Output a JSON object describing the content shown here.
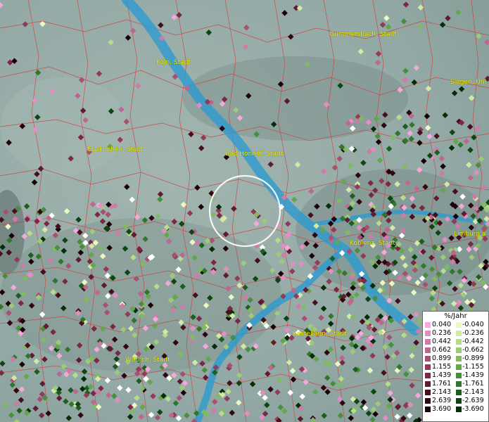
{
  "map": {
    "cities": [
      {
        "name": "Gummersbach, Stadt"
      },
      {
        "name": "Köln, Stadt"
      },
      {
        "name": "Siegen, Uni"
      },
      {
        "name": "Euskirchen, Stadt"
      },
      {
        "name": "Bad Honnef, Stadt"
      },
      {
        "name": "Koblenz, Stadt"
      },
      {
        "name": "Limburg a"
      },
      {
        "name": "Kastellaun, Stadt"
      },
      {
        "name": "Wittlich, Stadt"
      }
    ],
    "colors": {
      "river": "#2d9bd0",
      "boundary": "#d43a3a",
      "label": "#f2f200",
      "selection_ring": "#ffffff"
    }
  },
  "legend": {
    "title": "%/Jahr",
    "positive": [
      {
        "label": "0.040",
        "color": "#f4a8dc"
      },
      {
        "label": "0.236",
        "color": "#e18ec2"
      },
      {
        "label": "0.442",
        "color": "#cf7aa8"
      },
      {
        "label": "0.662",
        "color": "#bd6790"
      },
      {
        "label": "0.899",
        "color": "#a85074"
      },
      {
        "label": "1.155",
        "color": "#923a5a"
      },
      {
        "label": "1.439",
        "color": "#7b2844"
      },
      {
        "label": "1.761",
        "color": "#621a30"
      },
      {
        "label": "2.143",
        "color": "#480e1e"
      },
      {
        "label": "2.639",
        "color": "#300610"
      },
      {
        "label": "3.690",
        "color": "#1c0107"
      }
    ],
    "negative": [
      {
        "label": "-0.040",
        "color": "#eef7c2"
      },
      {
        "label": "-0.236",
        "color": "#d2eaa6"
      },
      {
        "label": "-0.442",
        "color": "#b7dc8d"
      },
      {
        "label": "-0.662",
        "color": "#9ccc78"
      },
      {
        "label": "-0.899",
        "color": "#81ba63"
      },
      {
        "label": "-1.155",
        "color": "#64a64e"
      },
      {
        "label": "-1.439",
        "color": "#488f3c"
      },
      {
        "label": "-1.761",
        "color": "#30772c"
      },
      {
        "label": "-2.143",
        "color": "#1d5e1e"
      },
      {
        "label": "-2.639",
        "color": "#0f4512"
      },
      {
        "label": "-3.690",
        "color": "#052e08"
      }
    ]
  }
}
